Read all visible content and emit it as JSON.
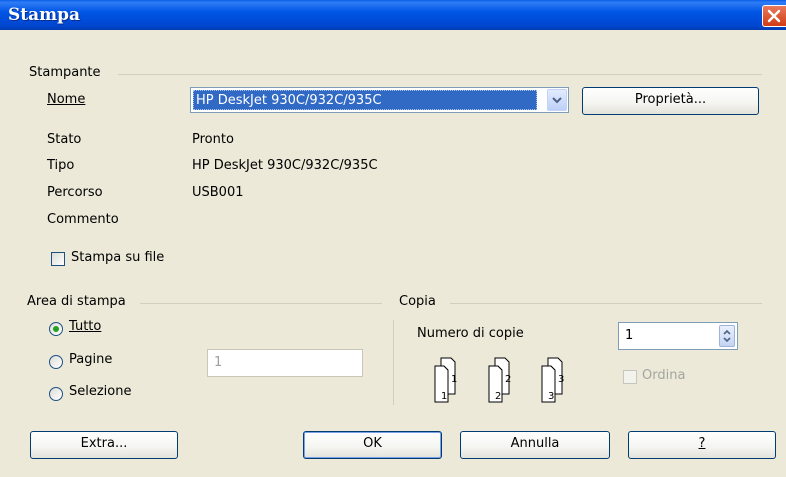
{
  "dialog": {
    "title": "Stampa"
  },
  "printer": {
    "group_label": "Stampante",
    "name_label": "Nome",
    "name_value": "HP DeskJet 930C/932C/935C",
    "properties_label": "Proprietà...",
    "status_label": "Stato",
    "status_value": "Pronto",
    "type_label": "Tipo",
    "type_value": "HP DeskJet 930C/932C/935C",
    "path_label": "Percorso",
    "path_value": "USB001",
    "comment_label": "Commento",
    "print_to_file_label": "Stampa su file",
    "print_to_file_checked": false
  },
  "print_range": {
    "group_label": "Area di stampa",
    "options": [
      "Tutto",
      "Pagine",
      "Selezione"
    ],
    "selected": "Tutto",
    "pages_value": "1"
  },
  "copies": {
    "group_label": "Copia",
    "count_label": "Numero di copie",
    "count_value": "1",
    "collate_label": "Ordina",
    "collate_enabled": false,
    "page_icons": [
      {
        "front": "1",
        "back": "1"
      },
      {
        "front": "2",
        "back": "2"
      },
      {
        "front": "3",
        "back": "3"
      }
    ]
  },
  "buttons": {
    "extra": "Extra...",
    "ok": "OK",
    "cancel": "Annulla",
    "help": "?"
  },
  "colors": {
    "titlebar": "#0055e5",
    "selection": "#316ac5",
    "radio_dot": "#21a121",
    "close": "#d13b14"
  },
  "icons": [
    "close-icon",
    "dropdown-arrow-icon",
    "spin-arrows-icon",
    "collate-page-icon"
  ]
}
